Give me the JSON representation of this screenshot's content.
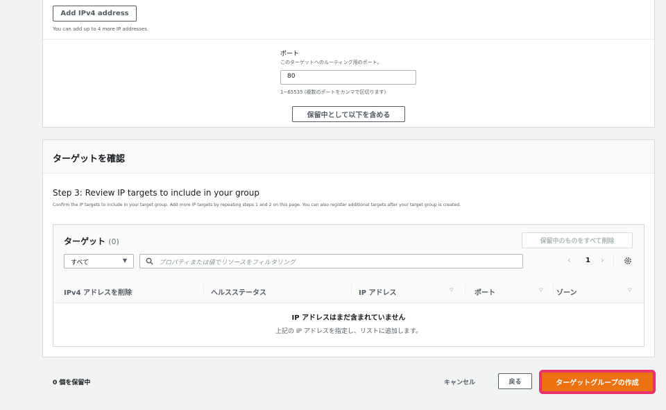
{
  "top": {
    "add_ipv4_label": "Add IPv4 address",
    "add_ip_hint": "You can add up to 4 more IP addresses.",
    "port_label": "ポート",
    "port_description": "このターゲットへのルーティング用のポート。",
    "port_value": "80",
    "port_hint": "1~65535 (複数のポートをカンマで区切ります)",
    "include_pending_label": "保留中として以下を含める"
  },
  "review": {
    "title": "ターゲットを確認",
    "step_title": "Step 3: Review IP targets to include in your group",
    "step_description": "Confirm the IP targets to include in your target group. Add more IP targets by repeating steps 1 and 2 on this page. You can also register additional targets after your target group is created."
  },
  "table": {
    "title": "ターゲット",
    "count": "(0)",
    "remove_all_label": "保留中のものをすべて削除",
    "filter_select_value": "すべて",
    "search_placeholder": "プロパティまたは値でリソースをフィルタリング",
    "page_number": "1",
    "columns": [
      "IPv4 アドレスを削除",
      "ヘルスステータス",
      "IP アドレス",
      "ポート",
      "ゾーン"
    ],
    "empty_title": "IP アドレスはまだ含まれていません",
    "empty_description": "上記の IP アドレスを指定し、リストに追加します。"
  },
  "footer": {
    "pending_count": "0 個を保留中",
    "cancel_label": "キャンセル",
    "back_label": "戻る",
    "create_label": "ターゲットグループの作成"
  },
  "colors": {
    "primary": "#ec7211",
    "highlight": "#e8336b"
  },
  "icons": [
    "caret-down-icon",
    "search-icon",
    "chevron-left-icon",
    "chevron-right-icon",
    "gear-icon",
    "sort-icon"
  ]
}
